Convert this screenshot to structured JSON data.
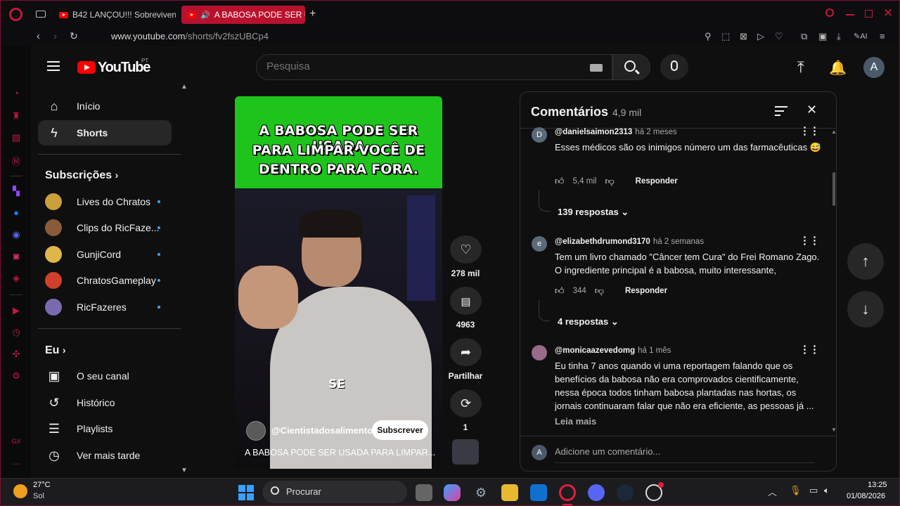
{
  "browser": {
    "tabs": [
      {
        "label": "B42 LANÇOU!!! Sobreviven",
        "active": false
      },
      {
        "label": "A BABOSA PODE SER U",
        "active": true
      }
    ],
    "url_domain": "www.youtube.com",
    "url_path": "/shorts/fv2fszUBCp4",
    "ai_label": "AI"
  },
  "youtube": {
    "logo_text": "YouTube",
    "region": "PT",
    "search_placeholder": "Pesquisa",
    "avatar_letter": "A"
  },
  "guide": {
    "main": [
      {
        "label": "Início",
        "icon": "home-icon"
      },
      {
        "label": "Shorts",
        "icon": "shorts-icon",
        "active": true
      }
    ],
    "subscriptions_heading": "Subscrições",
    "subscriptions": [
      {
        "label": "Lives do Chratos",
        "color": "#c9a03a"
      },
      {
        "label": "Clips do RicFaze...",
        "color": "#8a5a3a"
      },
      {
        "label": "GunjiCord",
        "color": "#e0b54a"
      },
      {
        "label": "ChratosGameplay",
        "color": "#d0402a"
      },
      {
        "label": "RicFazeres",
        "color": "#7a6ab0"
      }
    ],
    "you_heading": "Eu",
    "you": [
      {
        "label": "O seu canal",
        "icon": "channel-icon"
      },
      {
        "label": "Histórico",
        "icon": "history-icon"
      },
      {
        "label": "Playlists",
        "icon": "playlists-icon"
      },
      {
        "label": "Ver mais tarde",
        "icon": "watch-later-icon"
      }
    ]
  },
  "video": {
    "caption_lines": [
      "A BABOSA PODE SER USADA",
      "PARA LIMPAR VOCÊ DE",
      "DENTRO PARA FORA."
    ],
    "subtitle": "SE",
    "channel": "@Cientistadosalimento",
    "subscribe_label": "Subscrever",
    "title": "A BABOSA PODE SER USADA PARA LIMPAR..."
  },
  "actions": {
    "likes": "278 mil",
    "comments": "4963",
    "share": "Partilhar",
    "remix": "1"
  },
  "comments_panel": {
    "title": "Comentários",
    "count": "4,9 mil",
    "add_placeholder": "Adicione um comentário...",
    "items": [
      {
        "avatar": "D",
        "avatar_color": "#5a6a7a",
        "author": "@danielsaimon2313",
        "time": "há 2 meses",
        "text": "Esses médicos são os inimigos número um das farmacêuticas 😅",
        "likes": "5,4 mil",
        "reply": "Responder",
        "replies": "139 respostas"
      },
      {
        "avatar": "e",
        "avatar_color": "#5a6a7a",
        "author": "@elizabethdrumond3170",
        "time": "há 2 semanas",
        "text": "Tem um livro chamado \"Câncer tem Cura\" do Frei Romano Zago. O ingrediente principal é a babosa, muito interessante,",
        "likes": "344",
        "reply": "Responder",
        "replies": "4 respostas"
      },
      {
        "avatar": "",
        "avatar_color": "#9a6a8a",
        "author": "@monicaazevedomg",
        "time": "há 1 mês",
        "text": "Eu tinha 7 anos quando vi uma reportagem falando que os benefícios da babosa não era comprovados cientificamente, nessa época todos tinham babosa plantadas nas hortas, os jornais continuaram falar que não era eficiente, as pessoas já ...",
        "more": "Leia mais"
      }
    ]
  },
  "taskbar": {
    "weather_temp": "27°C",
    "weather_desc": "Sol",
    "search_label": "Procurar",
    "time": "13:25",
    "date": "01/08/2026"
  }
}
